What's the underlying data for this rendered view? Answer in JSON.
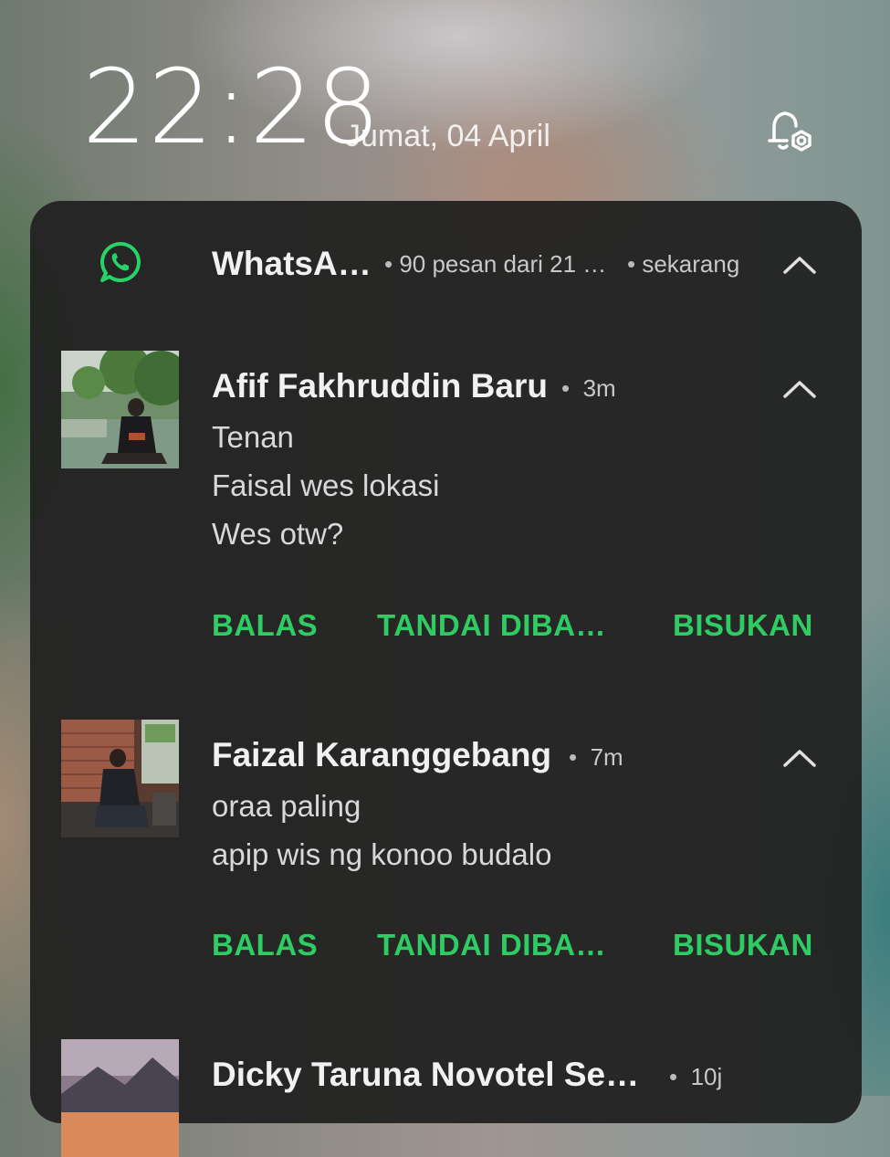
{
  "lockscreen": {
    "time": "22:28",
    "date": "Jumat, 04 April"
  },
  "group_header": {
    "app_name": "WhatsA…",
    "summary": "90 pesan dari 21 …",
    "time": "sekarang"
  },
  "notifications": [
    {
      "sender": "Afif Fakhruddin Baru",
      "time_ago": "3m",
      "messages": [
        "Tenan",
        "Faisal wes lokasi",
        "Wes otw?"
      ]
    },
    {
      "sender": "Faizal Karanggebang",
      "time_ago": "7m",
      "messages": [
        "oraa paling",
        "apip wis ng konoo budalo"
      ]
    },
    {
      "sender": "Dicky Taruna Novotel Se…",
      "time_ago": "10j",
      "messages": []
    }
  ],
  "actions": {
    "reply": "BALAS",
    "mark_read": "TANDAI DIBA…",
    "mute": "BISUKAN"
  },
  "colors": {
    "accent_green": "#2ecc62",
    "panel_bg": "#222222",
    "whatsapp_green": "#25d366"
  },
  "icons": {
    "app": "whatsapp-icon",
    "settings": "notification-settings-icon",
    "collapse": "chevron-up-icon"
  }
}
